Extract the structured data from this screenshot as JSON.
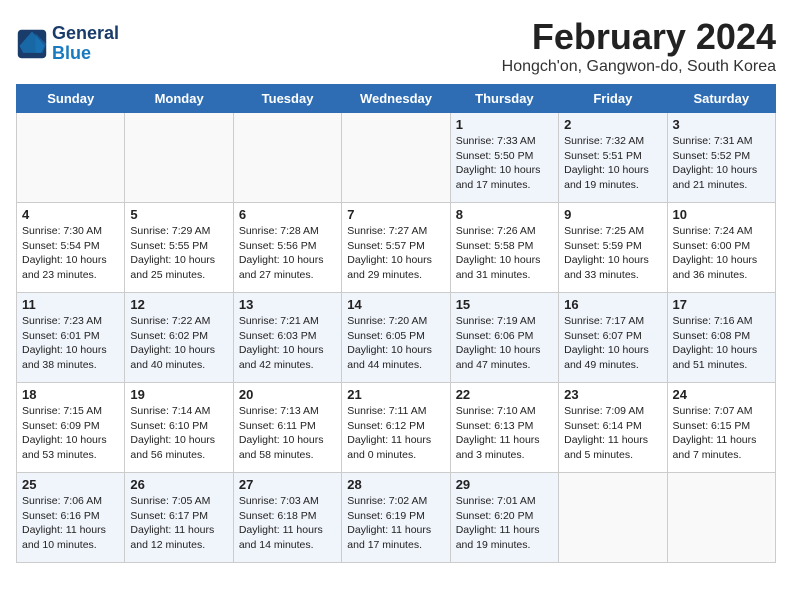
{
  "logo": {
    "line1": "General",
    "line2": "Blue"
  },
  "header": {
    "month_year": "February 2024",
    "location": "Hongch'on, Gangwon-do, South Korea"
  },
  "weekdays": [
    "Sunday",
    "Monday",
    "Tuesday",
    "Wednesday",
    "Thursday",
    "Friday",
    "Saturday"
  ],
  "weeks": [
    [
      {
        "day": "",
        "info": ""
      },
      {
        "day": "",
        "info": ""
      },
      {
        "day": "",
        "info": ""
      },
      {
        "day": "",
        "info": ""
      },
      {
        "day": "1",
        "info": "Sunrise: 7:33 AM\nSunset: 5:50 PM\nDaylight: 10 hours\nand 17 minutes."
      },
      {
        "day": "2",
        "info": "Sunrise: 7:32 AM\nSunset: 5:51 PM\nDaylight: 10 hours\nand 19 minutes."
      },
      {
        "day": "3",
        "info": "Sunrise: 7:31 AM\nSunset: 5:52 PM\nDaylight: 10 hours\nand 21 minutes."
      }
    ],
    [
      {
        "day": "4",
        "info": "Sunrise: 7:30 AM\nSunset: 5:54 PM\nDaylight: 10 hours\nand 23 minutes."
      },
      {
        "day": "5",
        "info": "Sunrise: 7:29 AM\nSunset: 5:55 PM\nDaylight: 10 hours\nand 25 minutes."
      },
      {
        "day": "6",
        "info": "Sunrise: 7:28 AM\nSunset: 5:56 PM\nDaylight: 10 hours\nand 27 minutes."
      },
      {
        "day": "7",
        "info": "Sunrise: 7:27 AM\nSunset: 5:57 PM\nDaylight: 10 hours\nand 29 minutes."
      },
      {
        "day": "8",
        "info": "Sunrise: 7:26 AM\nSunset: 5:58 PM\nDaylight: 10 hours\nand 31 minutes."
      },
      {
        "day": "9",
        "info": "Sunrise: 7:25 AM\nSunset: 5:59 PM\nDaylight: 10 hours\nand 33 minutes."
      },
      {
        "day": "10",
        "info": "Sunrise: 7:24 AM\nSunset: 6:00 PM\nDaylight: 10 hours\nand 36 minutes."
      }
    ],
    [
      {
        "day": "11",
        "info": "Sunrise: 7:23 AM\nSunset: 6:01 PM\nDaylight: 10 hours\nand 38 minutes."
      },
      {
        "day": "12",
        "info": "Sunrise: 7:22 AM\nSunset: 6:02 PM\nDaylight: 10 hours\nand 40 minutes."
      },
      {
        "day": "13",
        "info": "Sunrise: 7:21 AM\nSunset: 6:03 PM\nDaylight: 10 hours\nand 42 minutes."
      },
      {
        "day": "14",
        "info": "Sunrise: 7:20 AM\nSunset: 6:05 PM\nDaylight: 10 hours\nand 44 minutes."
      },
      {
        "day": "15",
        "info": "Sunrise: 7:19 AM\nSunset: 6:06 PM\nDaylight: 10 hours\nand 47 minutes."
      },
      {
        "day": "16",
        "info": "Sunrise: 7:17 AM\nSunset: 6:07 PM\nDaylight: 10 hours\nand 49 minutes."
      },
      {
        "day": "17",
        "info": "Sunrise: 7:16 AM\nSunset: 6:08 PM\nDaylight: 10 hours\nand 51 minutes."
      }
    ],
    [
      {
        "day": "18",
        "info": "Sunrise: 7:15 AM\nSunset: 6:09 PM\nDaylight: 10 hours\nand 53 minutes."
      },
      {
        "day": "19",
        "info": "Sunrise: 7:14 AM\nSunset: 6:10 PM\nDaylight: 10 hours\nand 56 minutes."
      },
      {
        "day": "20",
        "info": "Sunrise: 7:13 AM\nSunset: 6:11 PM\nDaylight: 10 hours\nand 58 minutes."
      },
      {
        "day": "21",
        "info": "Sunrise: 7:11 AM\nSunset: 6:12 PM\nDaylight: 11 hours\nand 0 minutes."
      },
      {
        "day": "22",
        "info": "Sunrise: 7:10 AM\nSunset: 6:13 PM\nDaylight: 11 hours\nand 3 minutes."
      },
      {
        "day": "23",
        "info": "Sunrise: 7:09 AM\nSunset: 6:14 PM\nDaylight: 11 hours\nand 5 minutes."
      },
      {
        "day": "24",
        "info": "Sunrise: 7:07 AM\nSunset: 6:15 PM\nDaylight: 11 hours\nand 7 minutes."
      }
    ],
    [
      {
        "day": "25",
        "info": "Sunrise: 7:06 AM\nSunset: 6:16 PM\nDaylight: 11 hours\nand 10 minutes."
      },
      {
        "day": "26",
        "info": "Sunrise: 7:05 AM\nSunset: 6:17 PM\nDaylight: 11 hours\nand 12 minutes."
      },
      {
        "day": "27",
        "info": "Sunrise: 7:03 AM\nSunset: 6:18 PM\nDaylight: 11 hours\nand 14 minutes."
      },
      {
        "day": "28",
        "info": "Sunrise: 7:02 AM\nSunset: 6:19 PM\nDaylight: 11 hours\nand 17 minutes."
      },
      {
        "day": "29",
        "info": "Sunrise: 7:01 AM\nSunset: 6:20 PM\nDaylight: 11 hours\nand 19 minutes."
      },
      {
        "day": "",
        "info": ""
      },
      {
        "day": "",
        "info": ""
      }
    ]
  ]
}
